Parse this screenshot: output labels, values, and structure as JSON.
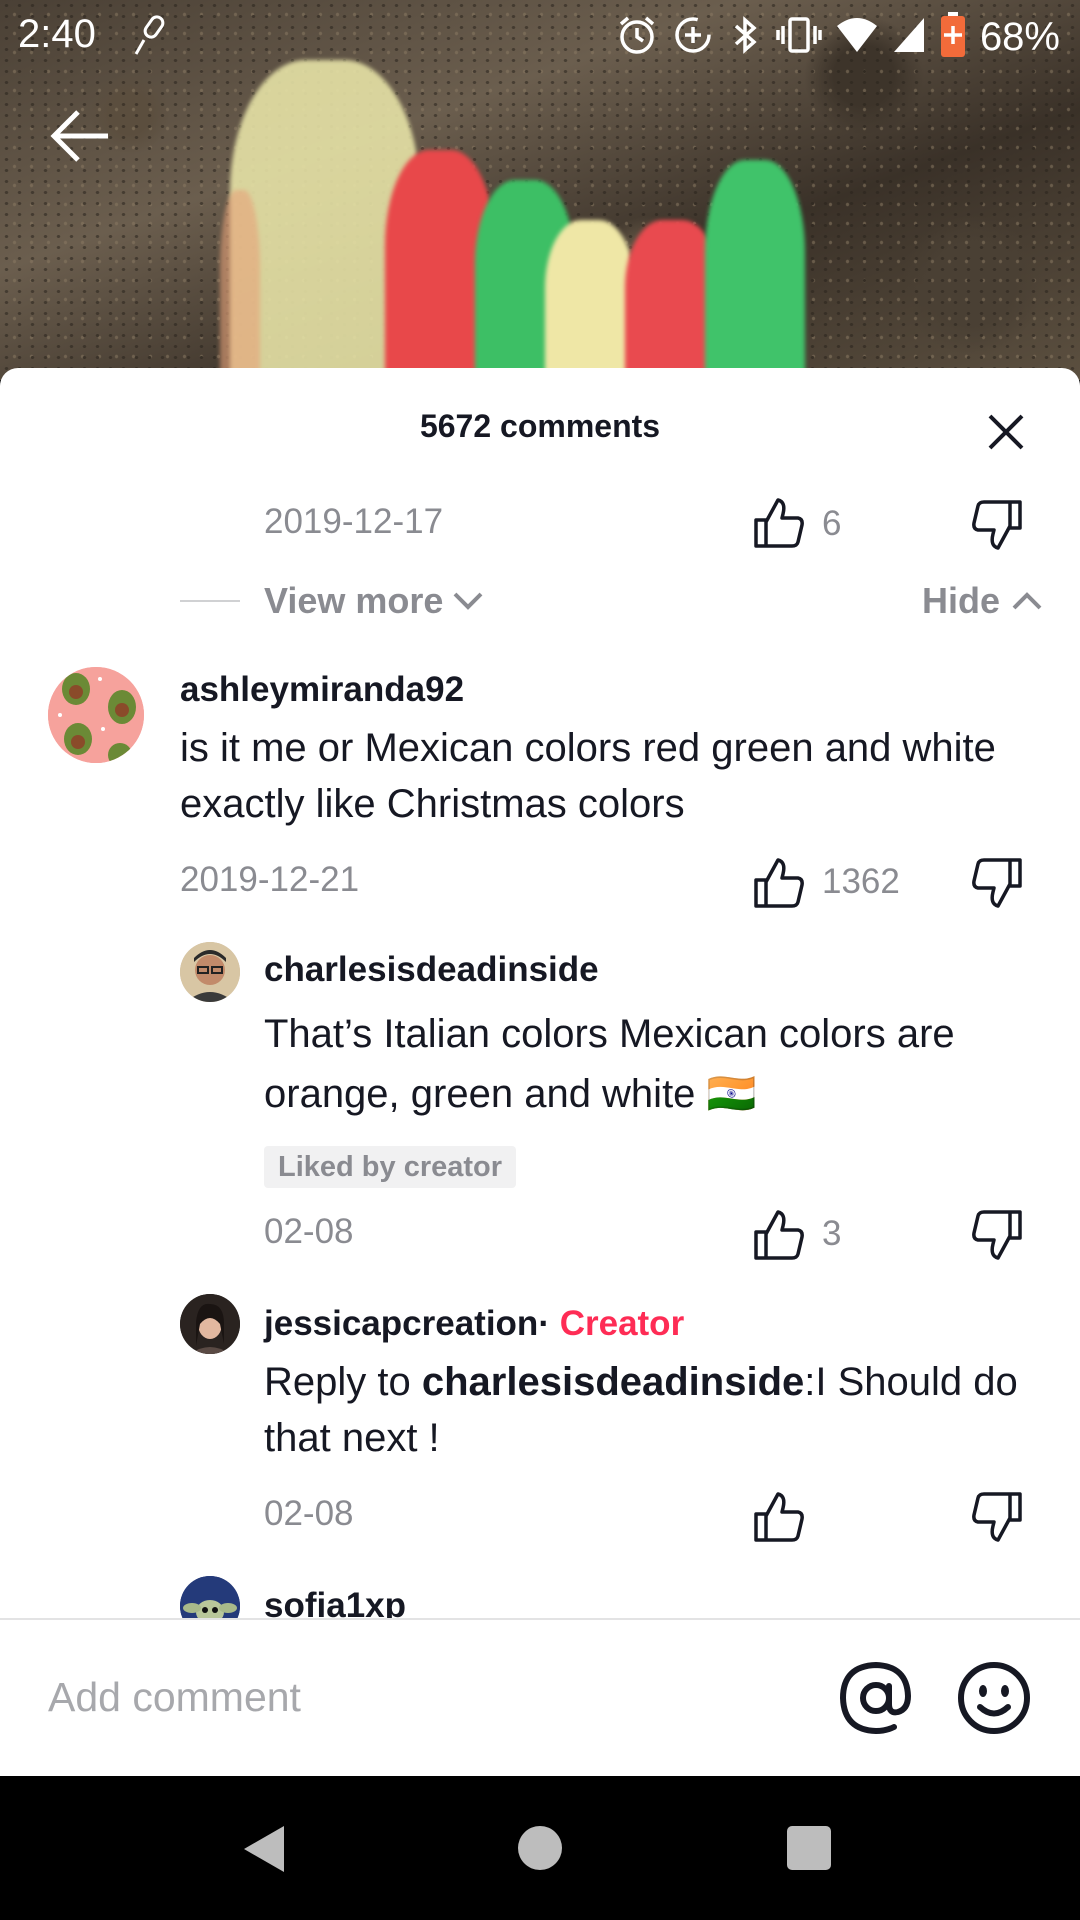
{
  "status_bar": {
    "time": "2:40",
    "battery": "68%",
    "icons": [
      "mic-icon",
      "alarm-icon",
      "data-saver-icon",
      "bluetooth-icon",
      "vibrate-icon",
      "wifi-icon",
      "signal-icon",
      "battery-icon"
    ]
  },
  "sheet": {
    "title": "5672 comments"
  },
  "prev_comment": {
    "date": "2019-12-17",
    "likes": "6"
  },
  "thread_controls": {
    "view_more": "View more",
    "hide": "Hide"
  },
  "comments": [
    {
      "username": "ashleymiranda92",
      "text": "is it me or Mexican colors red green and white exactly like Christmas colors",
      "date": "2019-12-21",
      "likes": "1362"
    }
  ],
  "replies": [
    {
      "username": "charlesisdeadinside",
      "text": "That’s Italian colors Mexican colors are orange, green and white",
      "flag": "🇮🇳",
      "badge": "Liked by creator",
      "date": "02-08",
      "likes": "3"
    },
    {
      "username": "jessicapcreation",
      "separator": "·",
      "creator_label": "Creator",
      "reply_prefix": "Reply to ",
      "reply_to": "charlesisdeadinside",
      "text": ":I Should do that next !",
      "date": "02-08",
      "likes": ""
    },
    {
      "username": "sofia1xp"
    }
  ],
  "footer": {
    "placeholder": "Add comment"
  },
  "colors": {
    "accent": "#fe2c55",
    "text_primary": "#161823",
    "text_secondary": "#8a8b91"
  }
}
